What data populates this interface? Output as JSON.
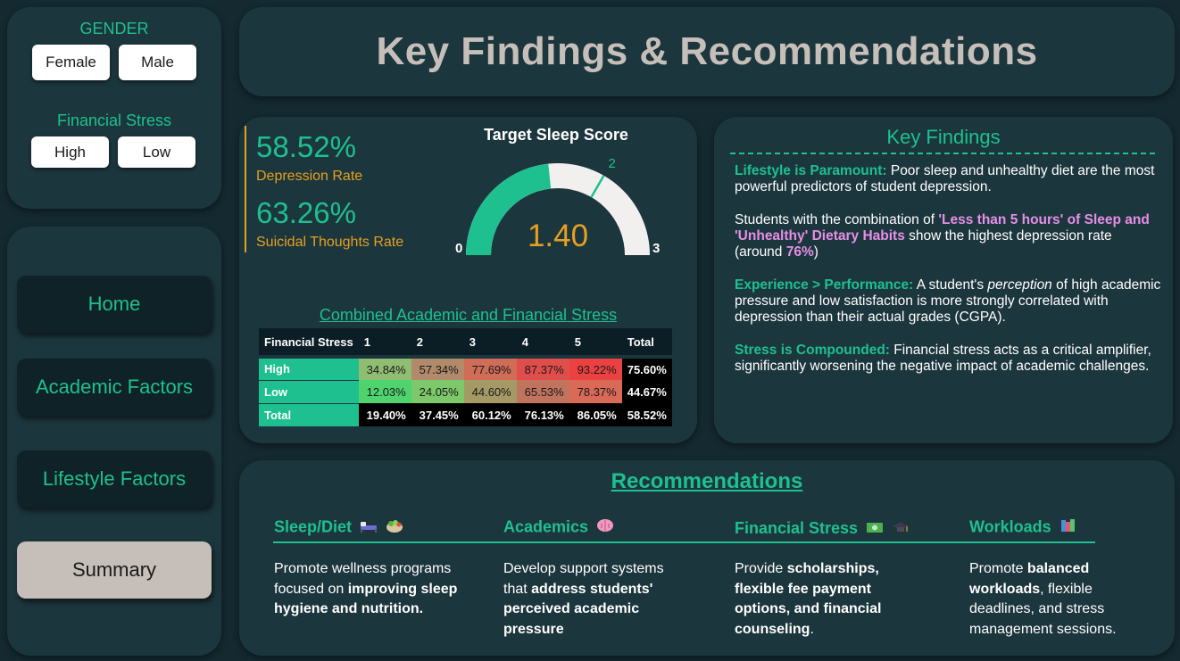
{
  "filters": {
    "gender": {
      "title": "GENDER",
      "options": [
        "Female",
        "Male"
      ]
    },
    "financial_stress": {
      "title": "Financial Stress",
      "options": [
        "High",
        "Low"
      ]
    }
  },
  "nav": {
    "home": "Home",
    "academic": "Academic Factors",
    "lifestyle": "Lifestyle Factors",
    "summary": "Summary"
  },
  "header": {
    "title": "Key Findings & Recommendations"
  },
  "kpis": {
    "depression": {
      "value": "58.52%",
      "label": "Depression Rate"
    },
    "suicidal": {
      "value": "63.26%",
      "label": "Suicidal Thoughts Rate"
    }
  },
  "gauge": {
    "title": "Target Sleep Score",
    "value": 1.4,
    "value_label": "1.40",
    "min": 0,
    "max": 3,
    "target": 2,
    "min_label": "0",
    "max_label": "3",
    "target_label": "2",
    "fill_color": "#1ec08f",
    "track_color": "#f2f0ee",
    "value_color": "#e5a020"
  },
  "stress_table": {
    "title": "Combined Academic and Financial Stress",
    "columns": [
      "Financial Stress",
      "1",
      "2",
      "3",
      "4",
      "5",
      "Total"
    ],
    "rows": [
      {
        "label": "High",
        "cells": [
          "34.84%",
          "57.34%",
          "77.69%",
          "87.37%",
          "93.22%"
        ],
        "total": "75.60%",
        "colors": [
          "#8fbd72",
          "#b08a6a",
          "#cf6d58",
          "#df4e4b",
          "#ec4141"
        ]
      },
      {
        "label": "Low",
        "cells": [
          "12.03%",
          "24.05%",
          "44.60%",
          "65.53%",
          "78.37%"
        ],
        "total": "44.67%",
        "colors": [
          "#4fd36f",
          "#7cc86a",
          "#a59a66",
          "#c0745e",
          "#d86a57"
        ]
      },
      {
        "label": "Total",
        "cells": [
          "19.40%",
          "37.45%",
          "60.12%",
          "76.13%",
          "86.05%"
        ],
        "total": "58.52%",
        "colors": [
          "#000000",
          "#000000",
          "#000000",
          "#000000",
          "#000000"
        ]
      }
    ]
  },
  "findings": {
    "title": "Key Findings",
    "f1_head": "Lifestyle is Paramount:",
    "f1_body": " Poor sleep and unhealthy diet are the most powerful predictors of student depression.",
    "f2_a": "Students with the combination of ",
    "f2_hl": " 'Less than 5 hours' of Sleep and 'Unhealthy' Dietary Habits ",
    "f2_b": " show the highest depression rate (around ",
    "f2_pct": "76%",
    "f2_c": ")",
    "f3_head": "Experience > Performance:",
    "f3_a": " A student's ",
    "f3_em": "perception",
    "f3_b": " of high academic pressure and low satisfaction is more strongly correlated with depression than their actual grades (CGPA).",
    "f4_head": "Stress is Compounded:",
    "f4_body": " Financial stress acts as a critical amplifier, significantly worsening the negative impact of academic challenges."
  },
  "recommendations": {
    "title": "Recommendations",
    "sleep": {
      "heading": "Sleep/Diet",
      "icons": [
        "bed-icon",
        "salad-icon"
      ],
      "a": "Promote wellness programs focused on ",
      "b": "improving sleep hygiene and nutrition."
    },
    "academics": {
      "heading": "Academics",
      "icons": [
        "brain-icon"
      ],
      "a": "Develop support systems that ",
      "b": "address students' perceived academic pressure"
    },
    "financial": {
      "heading": "Financial Stress",
      "icons": [
        "money-icon",
        "graduation-cap-icon"
      ],
      "a": "Provide ",
      "b": "scholarships, flexible fee payment options, and financial counseling",
      "c": "."
    },
    "workloads": {
      "heading": "Workloads",
      "icons": [
        "books-icon"
      ],
      "a": "Promote ",
      "b": "balanced workloads",
      "c": ", flexible deadlines, and stress management sessions."
    }
  }
}
